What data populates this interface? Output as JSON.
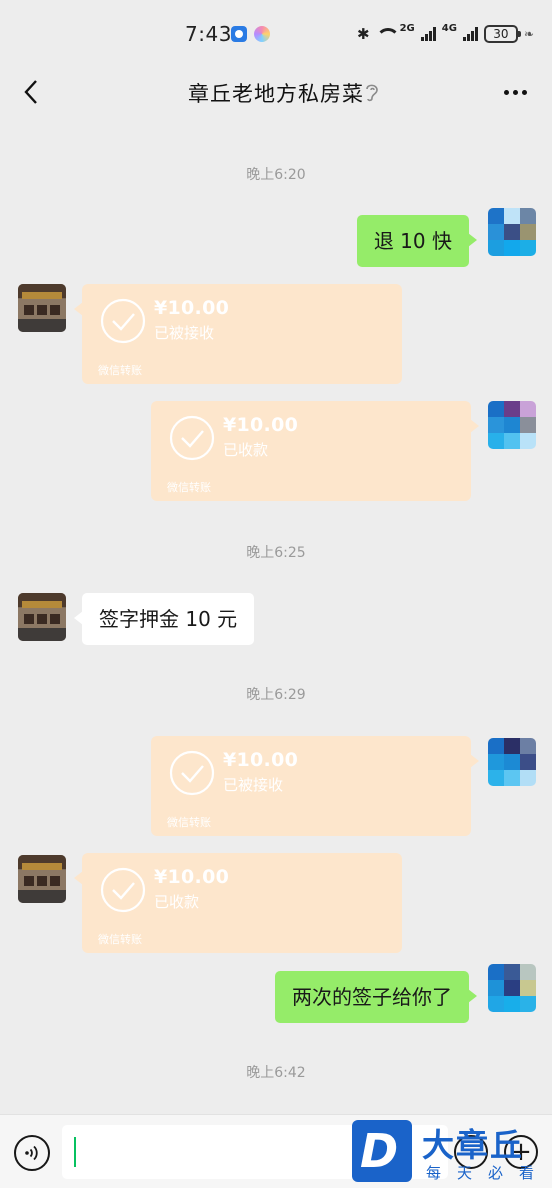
{
  "status_bar": {
    "time": "7:43",
    "network_a": "2G",
    "network_b": "4G",
    "battery": "30"
  },
  "header": {
    "title": "章丘老地方私房菜"
  },
  "messages": {
    "ts1": "晚上6:20",
    "m1_text": "退 10 快",
    "t1": {
      "amount": "¥10.00",
      "status": "已被接收",
      "footer": "微信转账"
    },
    "t2": {
      "amount": "¥10.00",
      "status": "已收款",
      "footer": "微信转账"
    },
    "ts2": "晚上6:25",
    "m2_text": "签字押金 10 元",
    "ts3": "晚上6:29",
    "t3": {
      "amount": "¥10.00",
      "status": "已被接收",
      "footer": "微信转账"
    },
    "t4": {
      "amount": "¥10.00",
      "status": "已收款",
      "footer": "微信转账"
    },
    "m3_text": "两次的签子给你了",
    "ts4": "晚上6:42"
  },
  "input_bar": {
    "message_value": ""
  },
  "watermark": {
    "logo_letter": "D",
    "title": "大章丘",
    "subtitle": "每天必看"
  },
  "colors": {
    "my_bubble": "#95ec69",
    "other_bubble": "#ffffff",
    "transfer_card": "#fde6cc",
    "background": "#ededed",
    "caret": "#07c160",
    "watermark": "#1a63c9"
  },
  "icons": [
    "bluetooth-icon",
    "wifi-icon",
    "signal-icon",
    "battery-icon",
    "back-icon",
    "ear-icon",
    "more-icon",
    "check-circle-icon",
    "voice-icon",
    "emoji-icon",
    "plus-icon"
  ]
}
